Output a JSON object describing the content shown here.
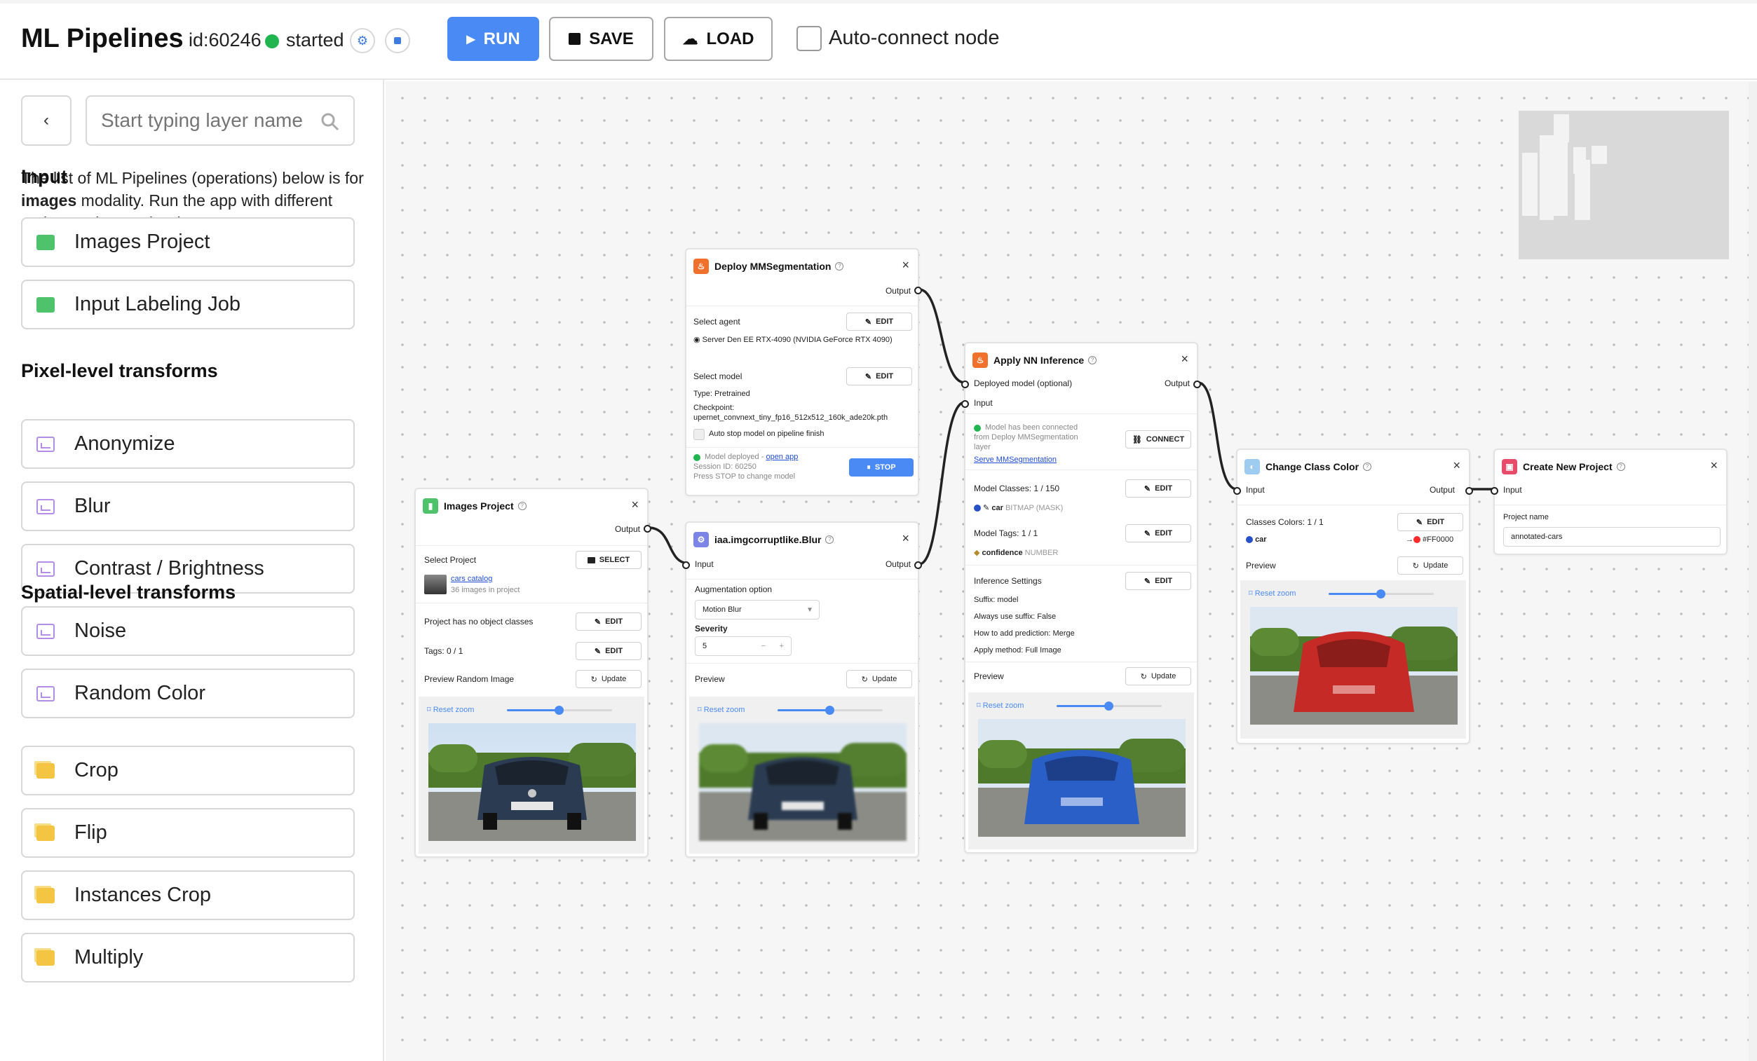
{
  "header": {
    "title": "ML Pipelines",
    "session_id": "id:60246",
    "status": "started",
    "run_label": "RUN",
    "save_label": "SAVE",
    "load_label": "LOAD",
    "autoconnect_label": "Auto-connect node",
    "status_color": "#21b54f",
    "accent_color": "#4a8af4"
  },
  "sidebar": {
    "search_placeholder": "Start typing layer name",
    "desc_pre": "The list of ML Pipelines (operations) below is for ",
    "desc_bold": "images",
    "desc_post": " modality. Run the app with different option to change the data type.",
    "sections": [
      {
        "title": "Input",
        "items": [
          "Images Project",
          "Input Labeling Job"
        ],
        "icon": "folder-icon"
      },
      {
        "title": "Pixel-level transforms",
        "items": [
          "Anonymize",
          "Blur",
          "Contrast / Brightness",
          "Noise",
          "Random Color"
        ],
        "icon": "image-icon"
      },
      {
        "title": "Spatial-level transforms",
        "items": [
          "Crop",
          "Flip",
          "Instances Crop",
          "Multiply"
        ],
        "icon": "crop-icon"
      }
    ]
  },
  "nodes": {
    "images_project": {
      "title": "Images Project",
      "output": "Output",
      "select_project": "Select Project",
      "select_btn": "SELECT",
      "project_name": "cars catalog",
      "project_count": "36 images in project",
      "no_classes": "Project has no object classes",
      "edit": "EDIT",
      "tags": "Tags: 0 / 1",
      "preview_random": "Preview Random Image",
      "update": "Update",
      "reset_zoom": "Reset zoom"
    },
    "deploy": {
      "title": "Deploy MMSegmentation",
      "output": "Output",
      "select_agent": "Select agent",
      "edit": "EDIT",
      "agent": "Server Den EE RTX-4090 (NVIDIA GeForce RTX 4090)",
      "select_model": "Select model",
      "type": "Type: Pretrained",
      "checkpoint_label": "Checkpoint:",
      "checkpoint": "upernet_convnext_tiny_fp16_512x512_160k_ade20k.pth",
      "auto_stop": "Auto stop model on pipeline finish",
      "deployed": "Model deployed - ",
      "open_app": "open app",
      "session": "Session ID: 60250",
      "press_stop": "Press STOP to change model",
      "stop": "STOP"
    },
    "blur": {
      "title": "iaa.imgcorruptlike.Blur",
      "input": "Input",
      "output": "Output",
      "aug_label": "Augmentation option",
      "aug_value": "Motion Blur",
      "severity_label": "Severity",
      "severity_value": "5",
      "preview": "Preview",
      "update": "Update",
      "reset_zoom": "Reset zoom"
    },
    "inference": {
      "title": "Apply NN Inference",
      "deployed_optional": "Deployed model (optional)",
      "output": "Output",
      "input": "Input",
      "connected_1": "Model has been connected",
      "connected_2": "from Deploy MMSegmentation",
      "connected_3": "layer",
      "serve_link": "Serve MMSegmentation",
      "connect": "CONNECT",
      "model_classes": "Model Classes: 1 / 150",
      "edit": "EDIT",
      "class_name": "car",
      "class_type": "BITMAP (MASK)",
      "model_tags": "Model Tags: 1 / 1",
      "tag_name": "confidence",
      "tag_type": "NUMBER",
      "inference_settings": "Inference Settings",
      "suffix": "Suffix: model",
      "always_suffix": "Always use suffix: False",
      "how_add": "How to add prediction: Merge",
      "apply_method": "Apply method: Full Image",
      "preview": "Preview",
      "update": "Update",
      "reset_zoom": "Reset zoom"
    },
    "change_color": {
      "title": "Change Class Color",
      "input": "Input",
      "output": "Output",
      "classes_colors": "Classes Colors: 1 / 1",
      "edit": "EDIT",
      "class_name": "car",
      "new_color": "#FF0000",
      "preview": "Preview",
      "update": "Update",
      "reset_zoom": "Reset zoom"
    },
    "new_project": {
      "title": "Create New Project",
      "input": "Input",
      "project_name_label": "Project name",
      "project_name_value": "annotated-cars"
    }
  }
}
